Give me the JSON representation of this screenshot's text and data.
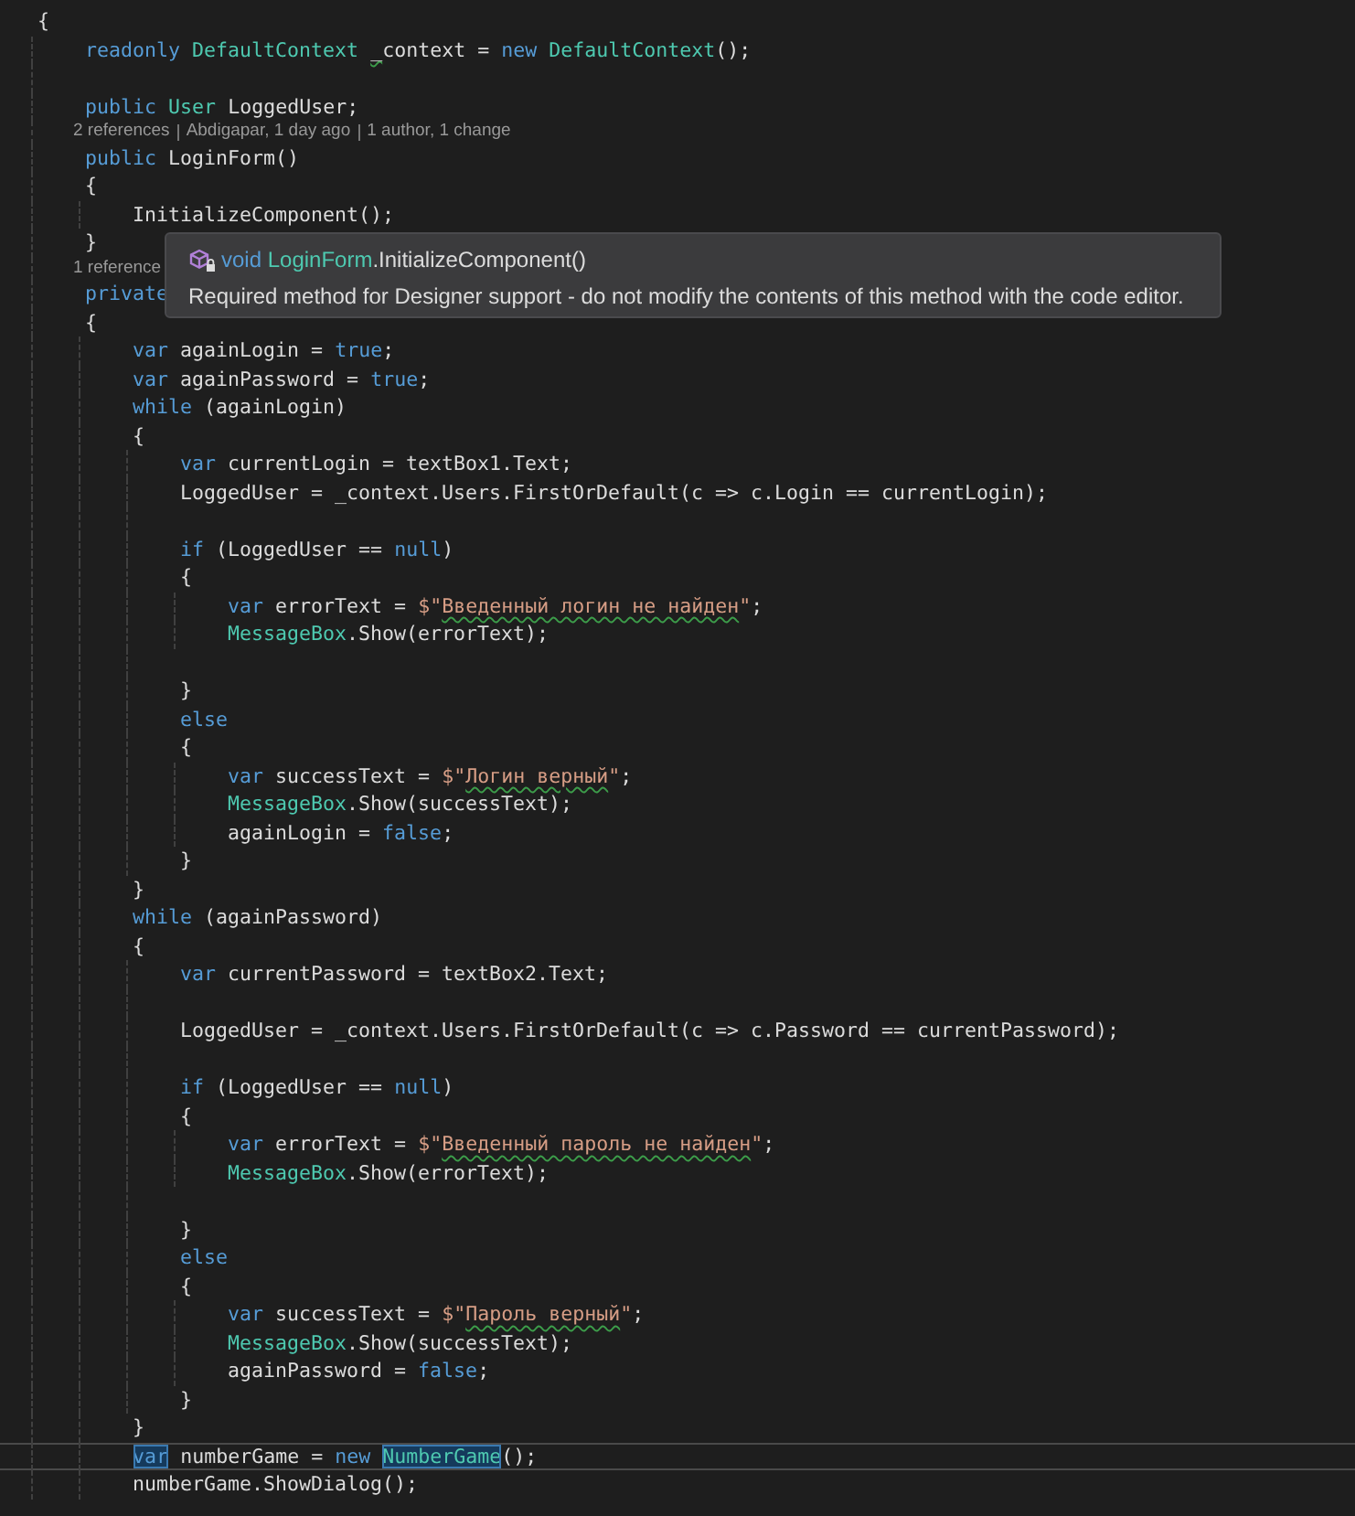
{
  "lines": [
    {
      "kind": "code",
      "current": false,
      "tokens": [
        {
          "kind": "plain",
          "text": "{"
        }
      ]
    },
    {
      "kind": "code",
      "current": false,
      "tokens": [
        {
          "kind": "kw",
          "text": "    readonly "
        },
        {
          "kind": "type",
          "text": "DefaultContext "
        },
        {
          "kind": "plainwarn",
          "text": "_"
        },
        {
          "kind": "plain",
          "text": "context = "
        },
        {
          "kind": "kw",
          "text": "new "
        },
        {
          "kind": "type",
          "text": "DefaultContext"
        },
        {
          "kind": "plain",
          "text": "();"
        }
      ]
    },
    {
      "kind": "blank"
    },
    {
      "kind": "code",
      "current": false,
      "tokens": [
        {
          "kind": "kw",
          "text": "    public "
        },
        {
          "kind": "type",
          "text": "User"
        },
        {
          "kind": "plain",
          "text": " LoggedUser;"
        }
      ]
    },
    {
      "kind": "codelens",
      "items": [
        "2 references",
        "Abdigapar, 1 day ago",
        "1 author, 1 change"
      ]
    },
    {
      "kind": "code",
      "current": false,
      "tokens": [
        {
          "kind": "kw",
          "text": "    public "
        },
        {
          "kind": "plain",
          "text": "LoginForm()"
        }
      ]
    },
    {
      "kind": "code",
      "current": false,
      "tokens": [
        {
          "kind": "plain",
          "text": "    {"
        }
      ]
    },
    {
      "kind": "code",
      "current": false,
      "tokens": [
        {
          "kind": "plain",
          "text": "        InitializeComponent();"
        }
      ]
    },
    {
      "kind": "code",
      "current": false,
      "tokens": [
        {
          "kind": "plain",
          "text": "    }"
        }
      ]
    },
    {
      "kind": "codelens",
      "items": [
        "1 reference"
      ]
    },
    {
      "kind": "code",
      "current": false,
      "tokens": [
        {
          "kind": "kw",
          "text": "    private"
        }
      ]
    },
    {
      "kind": "code",
      "current": false,
      "tokens": [
        {
          "kind": "plain",
          "text": "    {"
        }
      ]
    },
    {
      "kind": "code",
      "current": false,
      "tokens": [
        {
          "kind": "kw",
          "text": "        var "
        },
        {
          "kind": "plain",
          "text": "againLogin = "
        },
        {
          "kind": "kw",
          "text": "true"
        },
        {
          "kind": "plain",
          "text": ";"
        }
      ]
    },
    {
      "kind": "code",
      "current": false,
      "tokens": [
        {
          "kind": "kw",
          "text": "        var "
        },
        {
          "kind": "plain",
          "text": "againPassword = "
        },
        {
          "kind": "kw",
          "text": "true"
        },
        {
          "kind": "plain",
          "text": ";"
        }
      ]
    },
    {
      "kind": "code",
      "current": false,
      "tokens": [
        {
          "kind": "kw",
          "text": "        while "
        },
        {
          "kind": "plain",
          "text": "(againLogin)"
        }
      ]
    },
    {
      "kind": "code",
      "current": false,
      "tokens": [
        {
          "kind": "plain",
          "text": "        {"
        }
      ]
    },
    {
      "kind": "code",
      "current": false,
      "tokens": [
        {
          "kind": "kw",
          "text": "            var "
        },
        {
          "kind": "plain",
          "text": "currentLogin = textBox1.Text;"
        }
      ]
    },
    {
      "kind": "code",
      "current": false,
      "tokens": [
        {
          "kind": "plain",
          "text": "            LoggedUser = _context.Users.FirstOrDefault(c => c.Login == currentLogin);"
        }
      ]
    },
    {
      "kind": "blank"
    },
    {
      "kind": "code",
      "current": false,
      "tokens": [
        {
          "kind": "kw",
          "text": "            if "
        },
        {
          "kind": "plain",
          "text": "(LoggedUser == "
        },
        {
          "kind": "kw",
          "text": "null"
        },
        {
          "kind": "plain",
          "text": ")"
        }
      ]
    },
    {
      "kind": "code",
      "current": false,
      "tokens": [
        {
          "kind": "plain",
          "text": "            {"
        }
      ]
    },
    {
      "kind": "code",
      "current": false,
      "tokens": [
        {
          "kind": "kw",
          "text": "                var "
        },
        {
          "kind": "plain",
          "text": "errorText = "
        },
        {
          "kind": "str",
          "text": "$\""
        },
        {
          "kind": "strwarn",
          "text": "Введенный логин не найден"
        },
        {
          "kind": "str",
          "text": "\""
        },
        {
          "kind": "plain",
          "text": ";"
        }
      ]
    },
    {
      "kind": "code",
      "current": false,
      "tokens": [
        {
          "kind": "type",
          "text": "                MessageBox"
        },
        {
          "kind": "plain",
          "text": ".Show(errorText);"
        }
      ]
    },
    {
      "kind": "blank"
    },
    {
      "kind": "code",
      "current": false,
      "tokens": [
        {
          "kind": "plain",
          "text": "            }"
        }
      ]
    },
    {
      "kind": "code",
      "current": false,
      "tokens": [
        {
          "kind": "kw",
          "text": "            else"
        }
      ]
    },
    {
      "kind": "code",
      "current": false,
      "tokens": [
        {
          "kind": "plain",
          "text": "            {"
        }
      ]
    },
    {
      "kind": "code",
      "current": false,
      "tokens": [
        {
          "kind": "kw",
          "text": "                var "
        },
        {
          "kind": "plain",
          "text": "successText = "
        },
        {
          "kind": "str",
          "text": "$\""
        },
        {
          "kind": "strwarn",
          "text": "Логин верный"
        },
        {
          "kind": "str",
          "text": "\""
        },
        {
          "kind": "plain",
          "text": ";"
        }
      ]
    },
    {
      "kind": "code",
      "current": false,
      "tokens": [
        {
          "kind": "type",
          "text": "                MessageBox"
        },
        {
          "kind": "plain",
          "text": ".Show(successText);"
        }
      ]
    },
    {
      "kind": "code",
      "current": false,
      "tokens": [
        {
          "kind": "plain",
          "text": "                againLogin = "
        },
        {
          "kind": "kw",
          "text": "false"
        },
        {
          "kind": "plain",
          "text": ";"
        }
      ]
    },
    {
      "kind": "code",
      "current": false,
      "tokens": [
        {
          "kind": "plain",
          "text": "            }"
        }
      ]
    },
    {
      "kind": "code",
      "current": false,
      "tokens": [
        {
          "kind": "plain",
          "text": "        }"
        }
      ]
    },
    {
      "kind": "code",
      "current": false,
      "tokens": [
        {
          "kind": "kw",
          "text": "        while "
        },
        {
          "kind": "plain",
          "text": "(againPassword)"
        }
      ]
    },
    {
      "kind": "code",
      "current": false,
      "tokens": [
        {
          "kind": "plain",
          "text": "        {"
        }
      ]
    },
    {
      "kind": "code",
      "current": false,
      "tokens": [
        {
          "kind": "kw",
          "text": "            var "
        },
        {
          "kind": "plain",
          "text": "currentPassword = textBox2.Text;"
        }
      ]
    },
    {
      "kind": "blank"
    },
    {
      "kind": "code",
      "current": false,
      "tokens": [
        {
          "kind": "plain",
          "text": "            LoggedUser = _context.Users.FirstOrDefault(c => c.Password == currentPassword);"
        }
      ]
    },
    {
      "kind": "blank"
    },
    {
      "kind": "code",
      "current": false,
      "tokens": [
        {
          "kind": "kw",
          "text": "            if "
        },
        {
          "kind": "plain",
          "text": "(LoggedUser == "
        },
        {
          "kind": "kw",
          "text": "null"
        },
        {
          "kind": "plain",
          "text": ")"
        }
      ]
    },
    {
      "kind": "code",
      "current": false,
      "tokens": [
        {
          "kind": "plain",
          "text": "            {"
        }
      ]
    },
    {
      "kind": "code",
      "current": false,
      "tokens": [
        {
          "kind": "kw",
          "text": "                var "
        },
        {
          "kind": "plain",
          "text": "errorText = "
        },
        {
          "kind": "str",
          "text": "$\""
        },
        {
          "kind": "strwarn",
          "text": "Введенный пароль не найден"
        },
        {
          "kind": "str",
          "text": "\""
        },
        {
          "kind": "plain",
          "text": ";"
        }
      ]
    },
    {
      "kind": "code",
      "current": false,
      "tokens": [
        {
          "kind": "type",
          "text": "                MessageBox"
        },
        {
          "kind": "plain",
          "text": ".Show(errorText);"
        }
      ]
    },
    {
      "kind": "blank"
    },
    {
      "kind": "code",
      "current": false,
      "tokens": [
        {
          "kind": "plain",
          "text": "            }"
        }
      ]
    },
    {
      "kind": "code",
      "current": false,
      "tokens": [
        {
          "kind": "kw",
          "text": "            else"
        }
      ]
    },
    {
      "kind": "code",
      "current": false,
      "tokens": [
        {
          "kind": "plain",
          "text": "            {"
        }
      ]
    },
    {
      "kind": "code",
      "current": false,
      "tokens": [
        {
          "kind": "kw",
          "text": "                var "
        },
        {
          "kind": "plain",
          "text": "successText = "
        },
        {
          "kind": "str",
          "text": "$\""
        },
        {
          "kind": "strwarn",
          "text": "Пароль верный"
        },
        {
          "kind": "str",
          "text": "\""
        },
        {
          "kind": "plain",
          "text": ";"
        }
      ]
    },
    {
      "kind": "code",
      "current": false,
      "tokens": [
        {
          "kind": "type",
          "text": "                MessageBox"
        },
        {
          "kind": "plain",
          "text": ".Show(successText);"
        }
      ]
    },
    {
      "kind": "code",
      "current": false,
      "tokens": [
        {
          "kind": "plain",
          "text": "                againPassword = "
        },
        {
          "kind": "kw",
          "text": "false"
        },
        {
          "kind": "plain",
          "text": ";"
        }
      ]
    },
    {
      "kind": "code",
      "current": false,
      "tokens": [
        {
          "kind": "plain",
          "text": "            }"
        }
      ]
    },
    {
      "kind": "code",
      "current": false,
      "tokens": [
        {
          "kind": "plain",
          "text": "        }"
        }
      ]
    },
    {
      "kind": "code",
      "current": true,
      "tokens": [
        {
          "kind": "kwref",
          "text": "        var"
        },
        {
          "kind": "plain",
          "text": " numberGame = "
        },
        {
          "kind": "kw",
          "text": "new "
        },
        {
          "kind": "typeref",
          "text": "NumberGame"
        },
        {
          "kind": "plain",
          "text": "();"
        }
      ]
    },
    {
      "kind": "code",
      "current": false,
      "tokens": [
        {
          "kind": "plain",
          "text": "        numberGame.ShowDialog();"
        }
      ]
    }
  ],
  "tooltip": {
    "signature": [
      {
        "kind": "kw",
        "text": "void "
      },
      {
        "kind": "type",
        "text": "LoginForm"
      },
      {
        "kind": "plain",
        "text": ".InitializeComponent()"
      }
    ],
    "description": "Required method for Designer support - do not modify the contents of this method with the code editor."
  }
}
